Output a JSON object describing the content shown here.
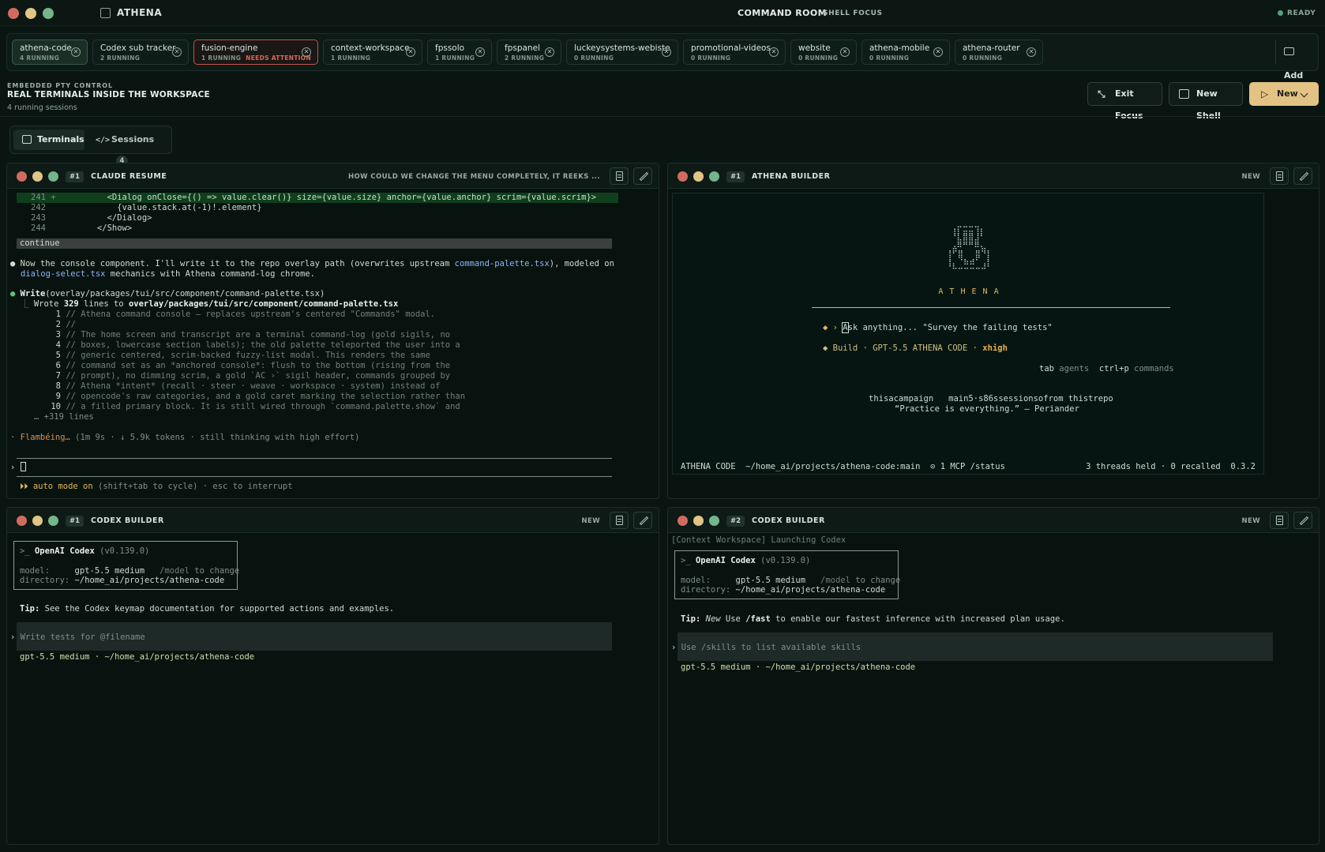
{
  "window": {
    "app_name": "ATHENA",
    "room_title": "COMMAND ROOM",
    "room_mode": "SHELL FOCUS",
    "status": "READY"
  },
  "project_tabs": [
    {
      "name": "athena-code",
      "status": "4 RUNNING",
      "attention": "",
      "active": true
    },
    {
      "name": "Codex sub tracker",
      "status": "2 RUNNING",
      "attention": ""
    },
    {
      "name": "fusion-engine",
      "status": "1 RUNNING",
      "attention": "NEEDS ATTENTION"
    },
    {
      "name": "context-workspace",
      "status": "1 RUNNING",
      "attention": ""
    },
    {
      "name": "fpssolo",
      "status": "1 RUNNING",
      "attention": ""
    },
    {
      "name": "fpspanel",
      "status": "2 RUNNING",
      "attention": ""
    },
    {
      "name": "luckeysystems-webiste",
      "status": "0 RUNNING",
      "attention": ""
    },
    {
      "name": "promotional-videos",
      "status": "0 RUNNING",
      "attention": ""
    },
    {
      "name": "website",
      "status": "0 RUNNING",
      "attention": ""
    },
    {
      "name": "athena-mobile",
      "status": "0 RUNNING",
      "attention": ""
    },
    {
      "name": "athena-router",
      "status": "0 RUNNING",
      "attention": ""
    }
  ],
  "add_label": "Add",
  "header": {
    "kicker": "EMBEDDED PTY CONTROL",
    "title": "REAL TERMINALS INSIDE THE WORKSPACE",
    "count": "4 running sessions",
    "exit_focus": "Exit Focus",
    "new_shell": "New Shell",
    "new": "New"
  },
  "segments": {
    "terminals": "Terminals",
    "sessions": "Sessions",
    "sessions_count": "4"
  },
  "panes": {
    "claude": {
      "num": "#1",
      "title": "CLAUDE RESUME",
      "tag": "HOW COULD WE CHANGE THE MENU COMPLETELY, IT REEKS ...",
      "diff": [
        {
          "n": "241 +",
          "code": "        <Dialog onClose={() => value.clear()} size={value.size} anchor={value.anchor} scrim={value.scrim}>"
        },
        {
          "n": "242",
          "code": "          {value.stack.at(-1)!.element}"
        },
        {
          "n": "243",
          "code": "        </Dialog>"
        },
        {
          "n": "244",
          "code": "      </Show>"
        }
      ],
      "continue": "continue",
      "msg1_a": "Now the console component. I'll write it to the repo overlay path (overwrites upstream ",
      "msg1_file": "command-palette.tsx",
      "msg1_b": "), modeled on",
      "msg2_file": "dialog-select.tsx",
      "msg2_b": " mechanics with Athena command-log chrome.",
      "write_tool": "Write",
      "write_path": "(overlay/packages/tui/src/component/command-palette.tsx)",
      "wrote_a": "Wrote ",
      "wrote_n": "329",
      "wrote_b": " lines to ",
      "wrote_path": "overlay/packages/tui/src/component/command-palette.tsx",
      "file_lines": [
        {
          "n": "1",
          "t": "// Athena command console — replaces upstream's centered \"Commands\" modal."
        },
        {
          "n": "2",
          "t": "//"
        },
        {
          "n": "3",
          "t": "// The home screen and transcript are a terminal command-log (gold sigils, no"
        },
        {
          "n": "4",
          "t": "// boxes, lowercase section labels); the old palette teleported the user into a"
        },
        {
          "n": "5",
          "t": "// generic centered, scrim-backed fuzzy-list modal. This renders the same"
        },
        {
          "n": "6",
          "t": "// command set as an *anchored console*: flush to the bottom (rising from the"
        },
        {
          "n": "7",
          "t": "// prompt), no dimming scrim, a gold `AC ›` sigil header, commands grouped by"
        },
        {
          "n": "8",
          "t": "// Athena *intent* (recall · steer · weave · workspace · system) instead of"
        },
        {
          "n": "9",
          "t": "// opencode's raw categories, and a gold caret marking the selection rather than"
        },
        {
          "n": "10",
          "t": "// a filled primary block. It is still wired through `command.palette.show` and"
        }
      ],
      "more_lines": "… +319 lines",
      "thinking_word": "· Flambéing…",
      "thinking_rest": " (1m 9s · ↓ 5.9k tokens · still thinking with high effort)",
      "prompt_char": "›",
      "auto_mode": "⏵⏵ auto mode on",
      "auto_rest": " (shift+tab to cycle) · esc to interrupt"
    },
    "athena": {
      "num": "#1",
      "title": "ATHENA BUILDER",
      "tag": "NEW",
      "logo_word": "A T H E N A",
      "ask_prefix": "◆ › ",
      "ask_cursor": "A",
      "ask_text": "sk anything... \"Survey the failing tests\"",
      "build_a": "◆ Build · GPT-5.5 ATHENA CODE · ",
      "build_effort": "xhigh",
      "tab_key": "tab",
      "tab_label": "agents",
      "ctrl_key": "ctrl+p",
      "ctrl_label": "commands",
      "tip_line": "thisacampaign   main5·s86ssessionsofrom thistrepo",
      "quote": "“Practice is everything.” — Periander",
      "footer_left": "ATHENA CODE  ~/home_ai/projects/athena-code:main  ⊙ 1 MCP /status",
      "footer_right": "3 threads held · 0 recalled  0.3.2"
    },
    "codex1": {
      "num": "#1",
      "title": "CODEX BUILDER",
      "tag": "NEW",
      "box_title_pre": ">_ ",
      "box_title": "OpenAI Codex",
      "box_version": " (v0.139.0)",
      "model_label": "model:     ",
      "model_value": "gpt-5.5 medium",
      "model_hint_cmd": "   /model",
      "model_hint": " to change",
      "dir_label": "directory: ",
      "dir_value": "~/home_ai/projects/athena-code",
      "tip_label": "Tip:",
      "tip_text": " See the Codex keymap documentation for supported actions and examples.",
      "prompt_placeholder": "Write tests for @filename",
      "status": "gpt-5.5 medium · ~/home_ai/projects/athena-code"
    },
    "codex2": {
      "num": "#2",
      "title": "CODEX BUILDER",
      "tag": "NEW",
      "launch": "[Context Workspace] Launching Codex",
      "box_title_pre": ">_ ",
      "box_title": "OpenAI Codex",
      "box_version": " (v0.139.0)",
      "model_label": "model:     ",
      "model_value": "gpt-5.5 medium",
      "model_hint_cmd": "   /model",
      "model_hint": " to change",
      "dir_label": "directory: ",
      "dir_value": "~/home_ai/projects/athena-code",
      "tip_label": "Tip:",
      "tip_new": " New",
      "tip_a": " Use ",
      "tip_cmd": "/fast",
      "tip_b": " to enable our fastest inference with increased plan usage.",
      "prompt_placeholder": "Use /skills to list available skills",
      "status": "gpt-5.5 medium · ~/home_ai/projects/athena-code"
    }
  },
  "colors": {
    "accent_gold": "#e2c384",
    "attention_red": "#d9685a",
    "ready_green": "#58a07a"
  }
}
